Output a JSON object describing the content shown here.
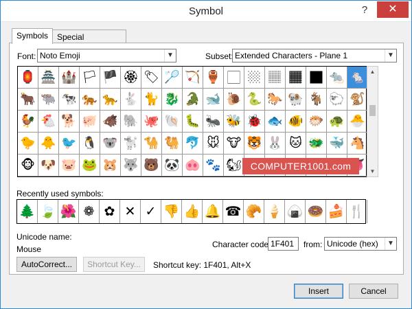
{
  "title": "Symbol",
  "help_glyph": "?",
  "close_glyph": "✕",
  "tabs": [
    {
      "label": "Symbols",
      "active": true
    },
    {
      "label": "Special Characters",
      "active": false
    }
  ],
  "font": {
    "label": "Font:",
    "value": "Noto Emoji"
  },
  "subset": {
    "label": "Subset:",
    "value": "Extended Characters - Plane 1"
  },
  "symbol_grid": [
    [
      "🏮",
      "🏯",
      "🏰",
      "🏳",
      "🏴",
      "🏵",
      "🏷",
      "🏸",
      "🏹",
      "🏺",
      "🏻",
      "🏼",
      "🏽",
      "🏾",
      "🏿",
      "🐀",
      "🐁"
    ],
    [
      "🐂",
      "🐃",
      "🐄",
      "🐅",
      "🐆",
      "🐇",
      "🐈",
      "🐉",
      "🐊",
      "🐋",
      "🐌",
      "🐍",
      "🐎",
      "🐏",
      "🐐",
      "🐑",
      "🐒"
    ],
    [
      "🐓",
      "🐔",
      "🐕",
      "🐖",
      "🐗",
      "🐘",
      "🐙",
      "🐚",
      "🐛",
      "🐜",
      "🐝",
      "🐞",
      "🐟",
      "🐠",
      "🐡",
      "🐢",
      "🐣"
    ],
    [
      "🐤",
      "🐥",
      "🐦",
      "🐧",
      "🐨",
      "🐩",
      "🐪",
      "🐫",
      "🐬",
      "🐭",
      "🐮",
      "🐯",
      "🐰",
      "🐱",
      "🐲",
      "🐳",
      "🐴"
    ],
    [
      "🐵",
      "🐶",
      "🐷",
      "🐸",
      "🐹",
      "🐺",
      "🐻",
      "🐼",
      "🐽",
      "🐾",
      "🐿",
      "👀",
      "👁",
      "👂",
      "👃",
      "👄",
      "👅"
    ]
  ],
  "selected_cell": {
    "row": 0,
    "col": 16
  },
  "watermark": "COMPUTER1001.com",
  "recent": {
    "label": "Recently used symbols:",
    "items": [
      "🌲",
      "🍃",
      "🌺",
      "❁",
      "✿",
      "✕",
      "✓",
      "👎",
      "👍",
      "🔔",
      "☎",
      "🥐",
      "🍦",
      "🍙",
      "🍩",
      "🍰",
      "🍴"
    ]
  },
  "unicode_name": {
    "label": "Unicode name:",
    "value": "Mouse"
  },
  "character_code": {
    "label": "Character code:",
    "value": "1F401"
  },
  "from": {
    "label": "from:",
    "value": "Unicode (hex)"
  },
  "buttons": {
    "autocorrect": "AutoCorrect...",
    "shortcut_key": "Shortcut Key...",
    "insert": "Insert",
    "cancel": "Cancel"
  },
  "shortcut_text": "Shortcut key: 1F401, Alt+X"
}
